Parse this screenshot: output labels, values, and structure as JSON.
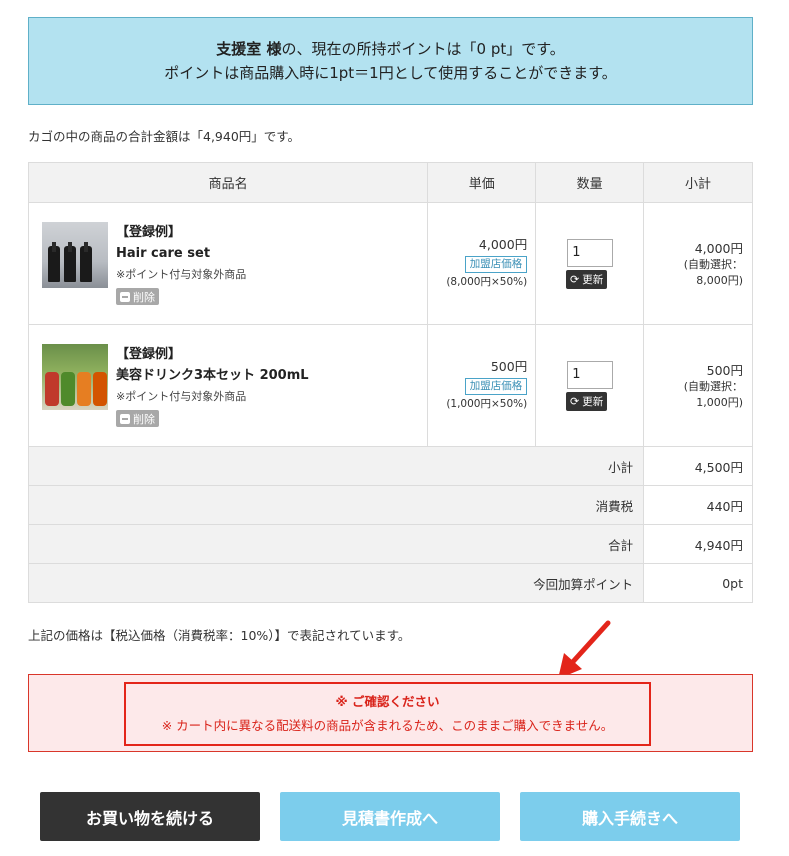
{
  "points": {
    "user_name": "支援室 様",
    "line1_rest": "の、現在の所持ポイントは「0 pt」です。",
    "line2": "ポイントは商品購入時に1pt＝1円として使用することができます。"
  },
  "cart_total_text": "カゴの中の商品の合計金額は「4,940円」です。",
  "table": {
    "headers": {
      "name": "商品名",
      "price": "単価",
      "qty": "数量",
      "subtotal": "小計"
    },
    "items": [
      {
        "image": "hair-care-bottles-image",
        "tag": "【登録例】",
        "title": "Hair care set",
        "note": "※ポイント付与対象外商品",
        "delete_label": "削除",
        "unit_price": "4,000円",
        "shop_price_label": "加盟店価格",
        "price_calc": "(8,000円×50%)",
        "qty": "1",
        "update_label": "更新",
        "subtotal": "4,000円",
        "auto_label": "(自動選択：",
        "auto_value": "8,000円)"
      },
      {
        "image": "beauty-drink-bottles-image",
        "tag": "【登録例】",
        "title": "美容ドリンク3本セット 200mL",
        "note": "※ポイント付与対象外商品",
        "delete_label": "削除",
        "unit_price": "500円",
        "shop_price_label": "加盟店価格",
        "price_calc": "(1,000円×50%)",
        "qty": "1",
        "update_label": "更新",
        "subtotal": "500円",
        "auto_label": "(自動選択：",
        "auto_value": "1,000円)"
      }
    ],
    "summary": [
      {
        "label": "小計",
        "value": "4,500円"
      },
      {
        "label": "消費税",
        "value": "440円"
      },
      {
        "label": "合計",
        "value": "4,940円"
      },
      {
        "label": "今回加算ポイント",
        "value": "0pt"
      }
    ]
  },
  "tax_note": "上記の価格は【税込価格（消費税率：10%）】で表記されています。",
  "alert": {
    "title": "※ ご確認ください",
    "message": "※ カート内に異なる配送料の商品が含まれるため、このままご購入できません。",
    "color": "#d9231a"
  },
  "buttons": {
    "continue": "お買い物を続ける",
    "quote": "見積書作成へ",
    "checkout": "購入手続きへ"
  },
  "icons": {
    "delete": "minus-square-icon",
    "update": "refresh-icon",
    "arrow": "red-arrow-icon"
  },
  "colors": {
    "accent": "#7ccdec",
    "points_bg": "#b3e2f0",
    "dark_button": "#333333",
    "alert_bg": "#fde9ea"
  }
}
